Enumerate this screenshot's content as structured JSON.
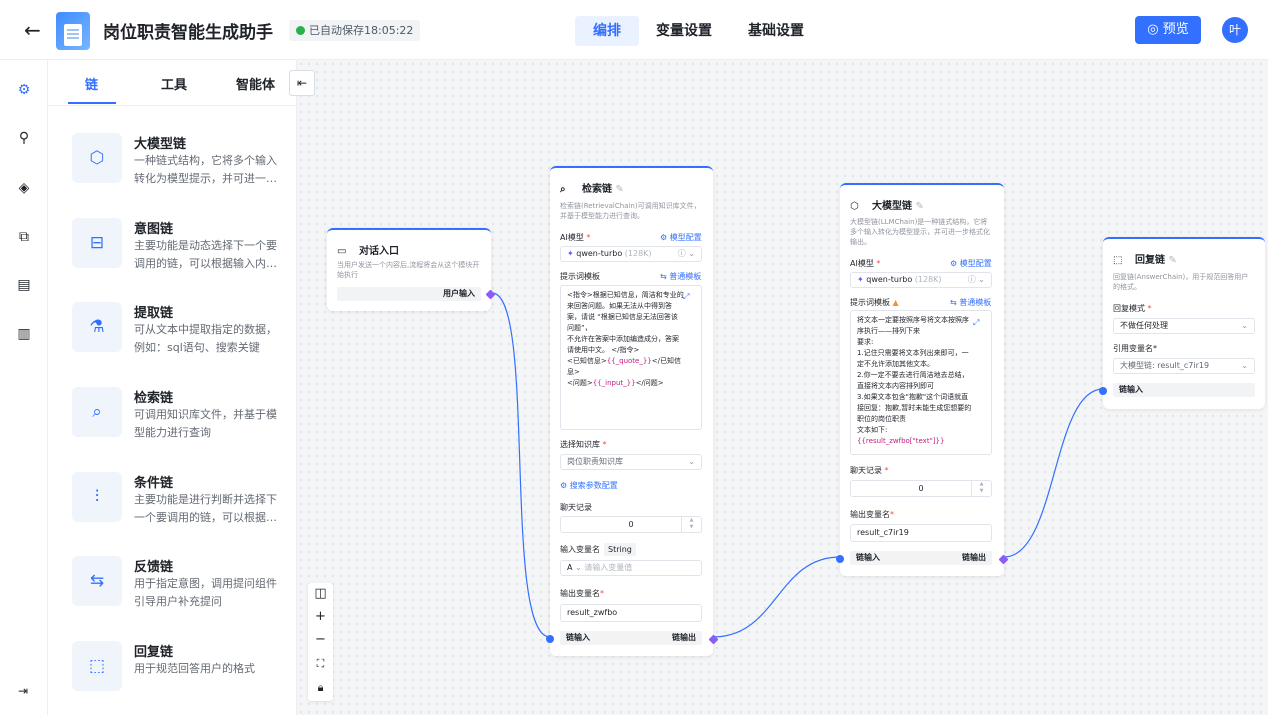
{
  "header": {
    "title": "岗位职责智能生成助手",
    "autosave": "已自动保存18:05:22",
    "tabs": [
      "编排",
      "变量设置",
      "基础设置"
    ],
    "preview": "预览",
    "avatar": "叶"
  },
  "panel": {
    "tabs": [
      "链",
      "工具",
      "智能体"
    ],
    "items": [
      {
        "title": "大模型链",
        "desc": "一种链式结构，它将多个输入转化为模型提示，并可进一…",
        "icon": "cube-icon"
      },
      {
        "title": "意图链",
        "desc": "主要功能是动态选择下一个要调用的链，可以根据输入内…",
        "icon": "branch-icon"
      },
      {
        "title": "提取链",
        "desc": "可从文本中提取指定的数据，例如：sql语句、搜索关键词…",
        "icon": "flask-icon"
      },
      {
        "title": "检索链",
        "desc": "可调用知识库文件，并基于模型能力进行查询",
        "icon": "search-doc-icon"
      },
      {
        "title": "条件链",
        "desc": "主要功能是进行判断并选择下一个要调用的链，可以根据…",
        "icon": "filter-icon"
      },
      {
        "title": "反馈链",
        "desc": "用于指定意图，调用提问组件引导用户补充提问",
        "icon": "feedback-icon"
      },
      {
        "title": "回复链",
        "desc": "用于规范回答用户的格式",
        "icon": "reply-icon"
      }
    ]
  },
  "nodes": {
    "entry": {
      "title": "对话入口",
      "desc": "当用户发送一个内容后,流程将会从这个模块开始执行",
      "output": "用户输入"
    },
    "retrieval": {
      "title": "检索链",
      "desc": "检索链(RetrievalChain)可调用知识库文件，并基于模型能力进行查询。",
      "model_label": "AI模型",
      "model_config": "模型配置",
      "model": "qwen-turbo",
      "model_ctx": "(128K)",
      "prompt_label": "提示词模板",
      "prompt_mode": "普通模板",
      "prompt_lines": [
        "<指令>根据已知信息，简洁和专业的",
        "来回答问题。如果无法从中得到答",
        "案，请说 “根据已知信息无法回答该",
        "问题”，",
        "不允许在答案中添加编造成分，答案",
        "请使用中文。 </指令>",
        "<已知信息>{{_quote_}}</已知信",
        "息>",
        "<问题>{{_input_}}</问题>"
      ],
      "kb_label": "选择知识库",
      "kb_value": "岗位职责知识库",
      "search_config": "搜索参数配置",
      "history_label": "聊天记录",
      "history_value": "0",
      "input_var_label": "输入变量名",
      "input_var_type": "String",
      "input_var_prefix": "A",
      "input_var_placeholder": "请输入变量值",
      "output_var_label": "输出变量名",
      "output_var_value": "result_zwfbo",
      "in": "链输入",
      "out": "链输出"
    },
    "llm": {
      "title": "大模型链",
      "desc": "大模型链(LLMChain)是一种链式结构，它将多个输入转化为模型提示，并可进一步格式化输出。",
      "model_label": "AI模型",
      "model_config": "模型配置",
      "model": "qwen-turbo",
      "model_ctx": "(128K)",
      "prompt_label": "提示词模板",
      "prompt_mode": "普通模板",
      "prompt_lines": [
        "将文本一定要按照序号将文本按照序",
        "序执行——排列下来",
        "要求:",
        "1.记住只需要将文本列出来即可，一",
        "定不允许添加其他文本。",
        "2.你一定不要去进行简洁地去总结，",
        "直接将文本内容排列即可",
        "3.如果文本包含\"抱歉\"这个词语就直",
        "接回复：抱歉,暂时未能生成您想要的",
        "职位的岗位职责",
        "文本如下:",
        "{{result_zwfbo[\"text\"]}}"
      ],
      "history_label": "聊天记录",
      "history_value": "0",
      "output_var_label": "输出变量名",
      "output_var_value": "result_c7ir19",
      "in": "链输入",
      "out": "链输出"
    },
    "reply": {
      "title": "回复链",
      "desc": "回复链(AnswerChain)，用于规范回答用户的格式。",
      "mode_label": "回复模式",
      "mode_value": "不做任何处理",
      "ref_label": "引用变量名",
      "ref_value": "大模型链: result_c7ir19",
      "in": "链输入"
    }
  },
  "colors": {
    "accent": "#3370ff",
    "output_port": "#8b5cf6"
  }
}
